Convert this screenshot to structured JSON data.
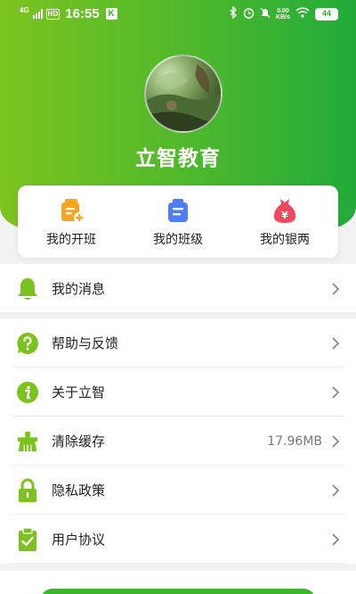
{
  "status_bar": {
    "network": "4G",
    "hd": "HD",
    "time": "16:55",
    "app_badge": "K",
    "speed_value": "0.00",
    "speed_unit": "KB/s",
    "battery": "44"
  },
  "profile": {
    "name": "立智教育"
  },
  "quick_actions": [
    {
      "label": "我的开班",
      "icon": "class-add-icon",
      "color": "#f5a623"
    },
    {
      "label": "我的班级",
      "icon": "class-list-icon",
      "color": "#4f7df5"
    },
    {
      "label": "我的银两",
      "icon": "money-bag-icon",
      "color": "#f0485e"
    }
  ],
  "menu": {
    "messages": {
      "label": "我的消息",
      "icon": "bell-icon"
    },
    "items": [
      {
        "label": "帮助与反馈",
        "icon": "question-icon",
        "value": ""
      },
      {
        "label": "关于立智",
        "icon": "info-icon",
        "value": ""
      },
      {
        "label": "清除缓存",
        "icon": "broom-icon",
        "value": "17.96MB"
      },
      {
        "label": "隐私政策",
        "icon": "lock-icon",
        "value": ""
      },
      {
        "label": "用户协议",
        "icon": "clipboard-check-icon",
        "value": ""
      }
    ]
  },
  "colors": {
    "brand_green": "#3fb52f",
    "icon_green": "#7cc21f"
  }
}
